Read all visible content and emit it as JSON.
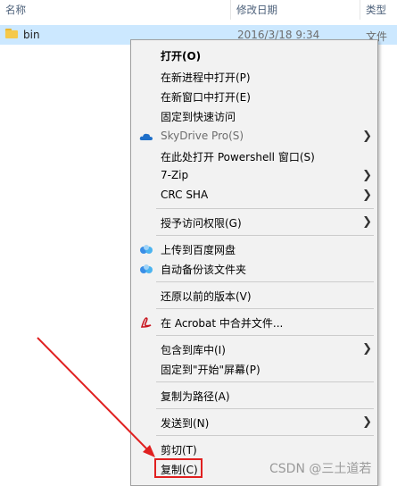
{
  "header": {
    "col_name": "名称",
    "col_date": "修改日期",
    "col_type": "类型"
  },
  "file_row": {
    "name": "bin",
    "date": "2016/3/18 9:34",
    "type": "文件夹"
  },
  "menu": {
    "open": "打开(O)",
    "open_new_process": "在新进程中打开(P)",
    "open_new_window": "在新窗口中打开(E)",
    "pin_quick_access": "固定到快速访问",
    "skydrive": "SkyDrive Pro(S)",
    "powershell": "在此处打开 Powershell 窗口(S)",
    "zip7": "7-Zip",
    "crc_sha": "CRC SHA",
    "give_access": "授予访问权限(G)",
    "upload_baidu": "上传到百度网盘",
    "auto_backup": "自动备份该文件夹",
    "restore_versions": "还原以前的版本(V)",
    "acrobat_merge": "在 Acrobat 中合并文件...",
    "include_library": "包含到库中(I)",
    "pin_start": "固定到\"开始\"屏幕(P)",
    "copy_path": "复制为路径(A)",
    "send_to": "发送到(N)",
    "cut": "剪切(T)",
    "copy": "复制(C)"
  },
  "watermark": "CSDN @三土道若",
  "colors": {
    "accent_selection": "#cce8ff",
    "highlight_red": "#e02020"
  }
}
